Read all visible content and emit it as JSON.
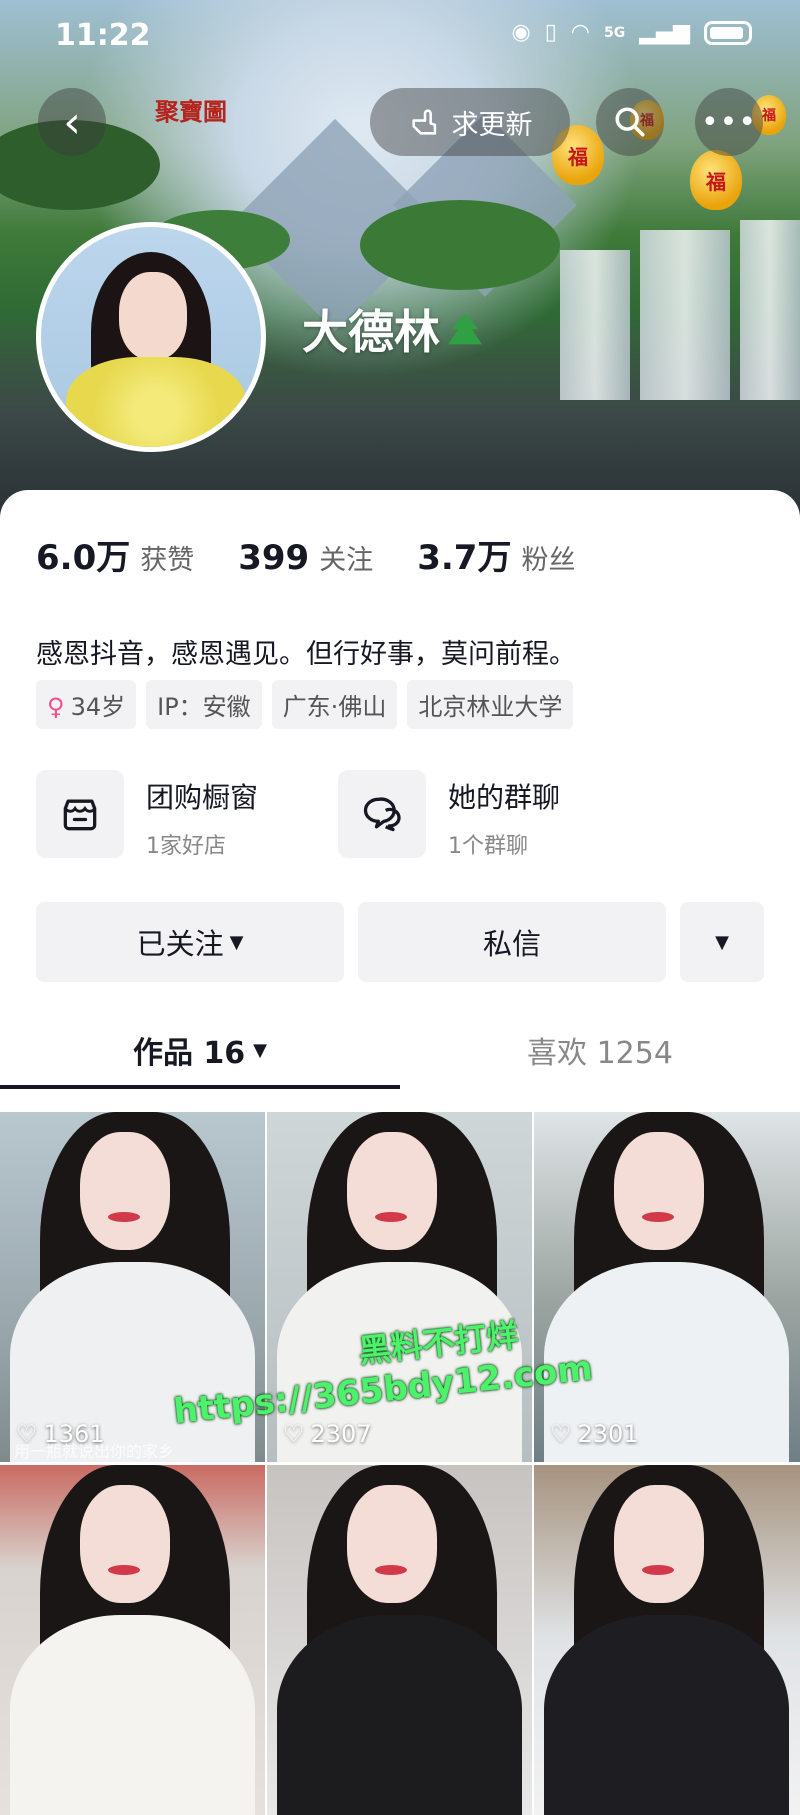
{
  "status_bar": {
    "time": "11:22",
    "network": "5G"
  },
  "header": {
    "update_label": "求更新",
    "seal_text": "聚寶圖",
    "gourd_text": "福"
  },
  "profile": {
    "nickname": "大德林",
    "stats": [
      {
        "value": "6.0万",
        "label": "获赞"
      },
      {
        "value": "399",
        "label": "关注"
      },
      {
        "value": "3.7万",
        "label": "粉丝"
      }
    ],
    "bio": "感恩抖音，感恩遇见。但行好事，莫问前程。",
    "tags": {
      "age": "34岁",
      "ip": "IP：安徽",
      "location": "广东·佛山",
      "school": "北京林业大学"
    }
  },
  "entries": {
    "shop": {
      "title": "团购橱窗",
      "sub": "1家好店"
    },
    "group": {
      "title": "她的群聊",
      "sub": "1个群聊"
    }
  },
  "actions": {
    "followed": "已关注",
    "message": "私信"
  },
  "tabs": {
    "works": "作品 16",
    "likes": "喜欢 1254"
  },
  "videos": [
    {
      "likes": "1361",
      "caption": "用一瓶就说出你的家乡"
    },
    {
      "likes": "2307"
    },
    {
      "likes": "2301"
    },
    {},
    {},
    {}
  ],
  "watermark": {
    "line1": "黑料不打烊",
    "line2": "https://365bdy12.com"
  },
  "colors": {
    "accent_female": "#f0508c",
    "watermark": "#4cf26a"
  }
}
